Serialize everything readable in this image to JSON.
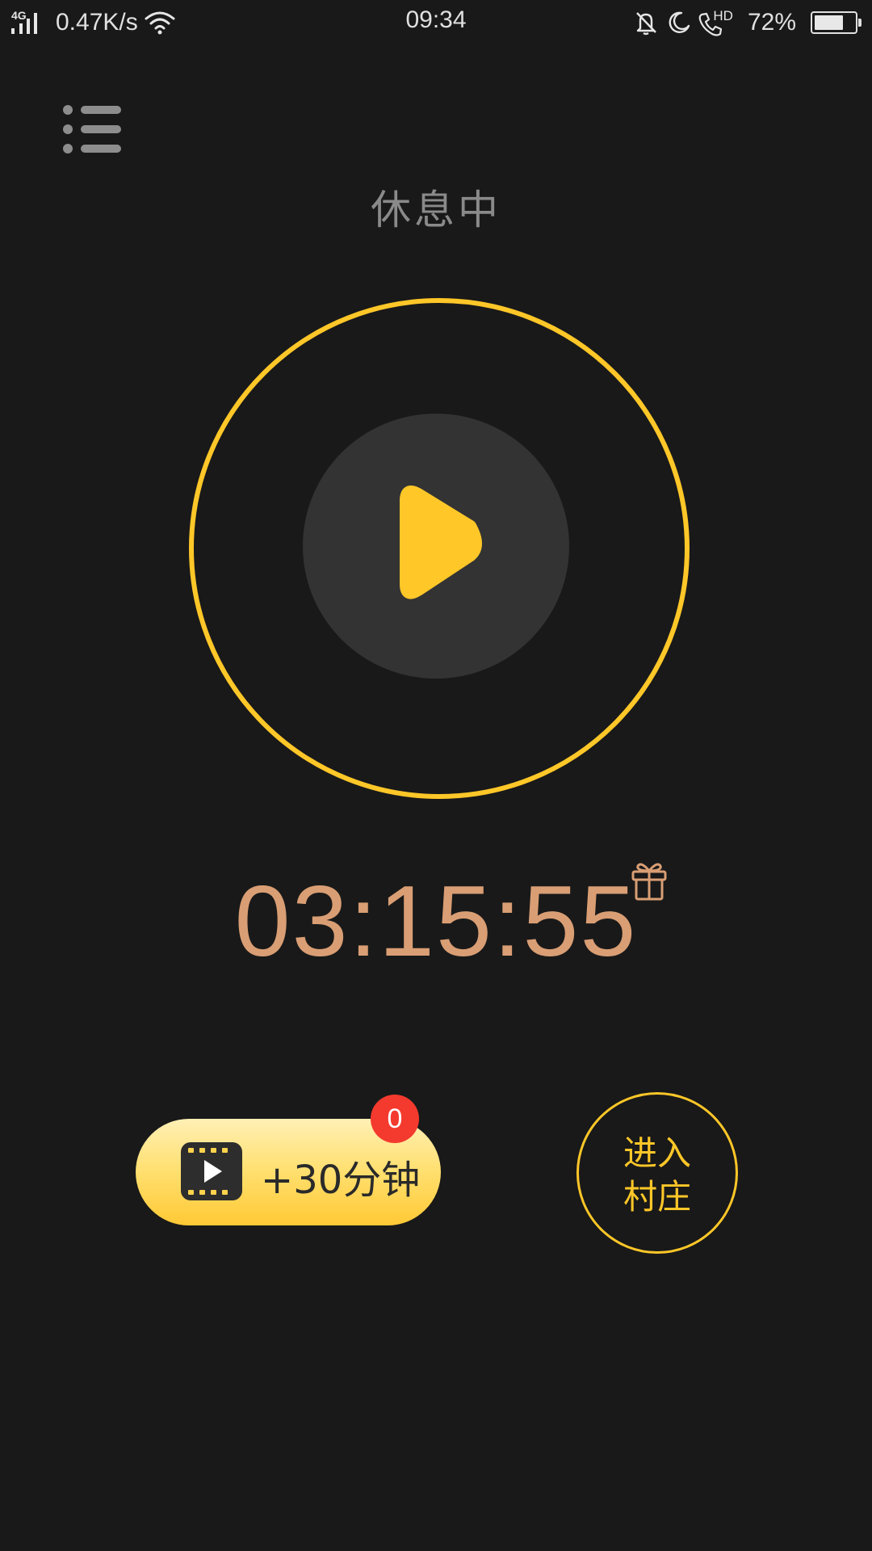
{
  "status_bar": {
    "network": "4G",
    "speed": "0.47K/s",
    "time": "09:34",
    "hd": "HD",
    "battery_percent": "72%",
    "battery_level": 0.72,
    "icons": [
      "signal-icon",
      "wifi-icon",
      "bell-off-icon",
      "moon-icon",
      "phone-hd-icon",
      "battery-icon"
    ]
  },
  "header": {
    "menu_icon": "menu-icon",
    "status_text": "休息中"
  },
  "player": {
    "play_icon": "play-icon",
    "ring_color": "#ffc728"
  },
  "timer": {
    "value": "03:15:55",
    "color": "#d99e74",
    "gift_icon": "gift-icon"
  },
  "actions": {
    "add_time_label": "+30分钟",
    "add_time_icon": "video-film-icon",
    "badge_count": "0",
    "village_label": "进入\n村庄"
  }
}
